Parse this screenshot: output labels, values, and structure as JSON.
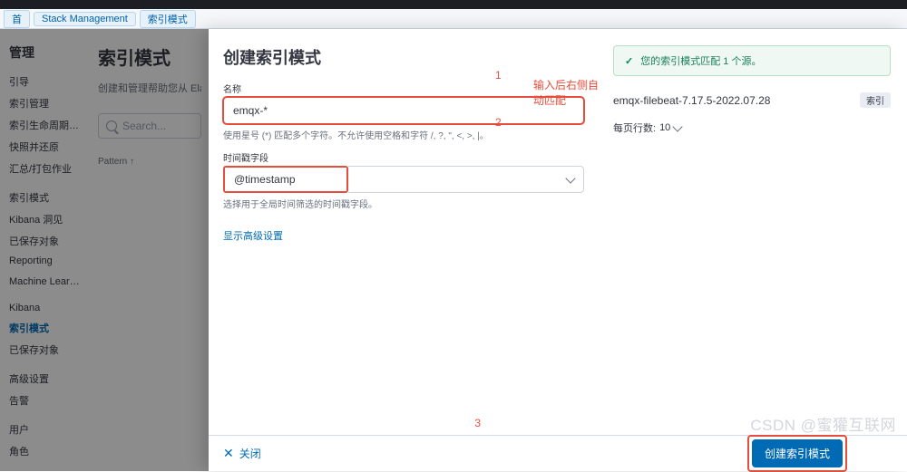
{
  "breadcrumb": {
    "home": "首",
    "stack_mgmt": "Stack Management",
    "index_patterns": "索引模式"
  },
  "sidebar": {
    "title": "管理",
    "items": [
      "引导",
      "索引管理",
      "索引生命周期策略",
      "快照并还原",
      "汇总/打包作业",
      "",
      "索引模式",
      "Kibana 洞见",
      "已保存对象",
      "Reporting",
      "Machine Learning 作业",
      "",
      "Kibana",
      "索引模式",
      "已保存对象",
      "",
      "高级设置",
      "告警",
      "",
      "用户",
      "角色"
    ]
  },
  "page": {
    "title": "索引模式",
    "desc": "创建和管理帮助您从 Elastics",
    "search_placeholder": "Search...",
    "pattern_col": "Pattern ↑"
  },
  "flyout": {
    "title": "创建索引模式",
    "name_label": "名称",
    "name_value": "emqx-*",
    "name_help": "使用星号 (*) 匹配多个字符。不允许使用空格和字符 /, ?, \", <, >, |。",
    "time_label": "时间戳字段",
    "time_value": "@timestamp",
    "time_help": "选择用于全局时间筛选的时间戳字段。",
    "advanced": "显示高级设置",
    "close": "关闭",
    "create": "创建索引模式"
  },
  "right": {
    "match_msg": "您的索引模式匹配 1 个源。",
    "matched_index": "emqx-filebeat-7.17.5-2022.07.28",
    "badge": "索引",
    "rows_label": "每页行数:",
    "rows_value": "10"
  },
  "annotations": {
    "a1": "1",
    "a1_note": "输入后右侧自动匹配",
    "a2": "2",
    "a3": "3"
  },
  "watermark": "CSDN @蜜獾互联网"
}
